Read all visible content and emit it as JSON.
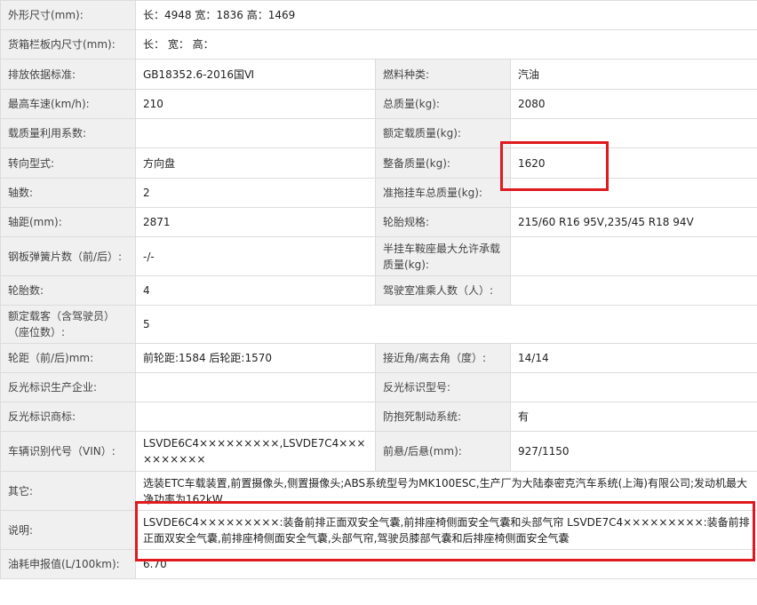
{
  "rows": [
    {
      "l1": "外形尺寸(mm):",
      "v1": "长：4948 宽：1836 高：1469"
    },
    {
      "l1": "货箱栏板内尺寸(mm):",
      "v1": "长：  宽：  高："
    },
    {
      "l1": "排放依据标准:",
      "v1": "GB18352.6-2016国Ⅵ",
      "l2": "燃料种类:",
      "v2": "汽油"
    },
    {
      "l1": "最高车速(km/h):",
      "v1": "210",
      "l2": "总质量(kg):",
      "v2": "2080"
    },
    {
      "l1": "载质量利用系数:",
      "v1": "",
      "l2": "额定载质量(kg):",
      "v2": ""
    },
    {
      "l1": "转向型式:",
      "v1": "方向盘",
      "l2": "整备质量(kg):",
      "v2": "1620"
    },
    {
      "l1": "轴数:",
      "v1": "2",
      "l2": "准拖挂车总质量(kg):",
      "v2": ""
    },
    {
      "l1": "轴距(mm):",
      "v1": "2871",
      "l2": "轮胎规格:",
      "v2": "215/60 R16 95V,235/45 R18 94V"
    },
    {
      "l1": "钢板弹簧片数（前/后）:",
      "v1": "-/-",
      "l2": "半挂车鞍座最大允许承载质量(kg):",
      "v2": ""
    },
    {
      "l1": "轮胎数:",
      "v1": "4",
      "l2": "驾驶室准乘人数（人）:",
      "v2": ""
    },
    {
      "l1": "额定载客（含驾驶员）（座位数）:",
      "v1": "5"
    },
    {
      "l1": "轮距（前/后)mm:",
      "v1": "前轮距:1584 后轮距:1570",
      "l2": "接近角/离去角（度）:",
      "v2": "14/14"
    },
    {
      "l1": "反光标识生产企业:",
      "v1": "",
      "l2": "反光标识型号:",
      "v2": ""
    },
    {
      "l1": "反光标识商标:",
      "v1": "",
      "l2": "防抱死制动系统:",
      "v2": "有"
    },
    {
      "l1": "车辆识别代号（VIN）:",
      "v1": "LSVDE6C4×××××××××,LSVDE7C4××××××××××",
      "l2": "前悬/后悬(mm):",
      "v2": "927/1150"
    },
    {
      "l1": "其它:",
      "v1": "选装ETC车载装置,前置摄像头,侧置摄像头;ABS系统型号为MK100ESC,生产厂为大陆泰密克汽车系统(上海)有限公司;发动机最大净功率为162kW"
    },
    {
      "l1": "说明:",
      "v1": "LSVDE6C4×××××××××:装备前排正面双安全气囊,前排座椅侧面安全气囊和头部气帘 LSVDE7C4×××××××××:装备前排正面双安全气囊,前排座椅侧面安全气囊,头部气帘,驾驶员膝部气囊和后排座椅侧面安全气囊"
    },
    {
      "l1": "油耗申报值(L/100km):",
      "v1": "6.70"
    }
  ]
}
